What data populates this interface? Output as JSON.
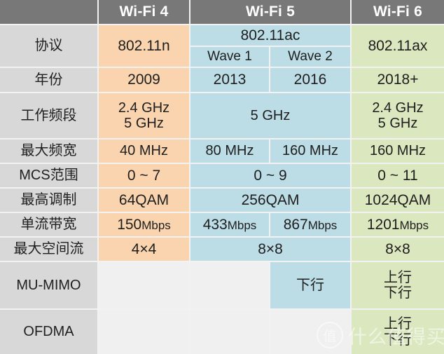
{
  "table": {
    "columns": [
      {
        "label": "",
        "name": "corner"
      },
      {
        "label": "Wi-Fi 4",
        "name": "wifi4"
      },
      {
        "label": "Wi-Fi 5",
        "name": "wifi5"
      },
      {
        "label": "Wi-Fi 6",
        "name": "wifi6"
      }
    ],
    "subcolumns": {
      "wifi5_wave1": "Wave 1",
      "wifi5_wave2": "Wave 2"
    },
    "rows": [
      {
        "label": "协议",
        "wifi4": "802.11n",
        "wifi5": "802.11ac",
        "wifi5_wave1": "Wave 1",
        "wifi5_wave2": "Wave 2",
        "wifi6": "802.11ax"
      },
      {
        "label": "年份",
        "wifi4": "2009",
        "wifi5_wave1": "2013",
        "wifi5_wave2": "2016",
        "wifi6": "2018+"
      },
      {
        "label": "工作频段",
        "wifi4_line1": "2.4 GHz",
        "wifi4_line2": "5 GHz",
        "wifi5": "5 GHz",
        "wifi6_line1": "2.4 GHz",
        "wifi6_line2": "5 GHz"
      },
      {
        "label": "最大频宽",
        "wifi4": "40 MHz",
        "wifi5_wave1": "80 MHz",
        "wifi5_wave2": "160 MHz",
        "wifi6": "160 MHz"
      },
      {
        "label": "MCS范围",
        "wifi4": "0 ~ 7",
        "wifi5": "0 ~ 9",
        "wifi6": "0 ~ 11"
      },
      {
        "label": "最高调制",
        "wifi4": "64QAM",
        "wifi5": "256QAM",
        "wifi6": "1024QAM"
      },
      {
        "label": "单流带宽",
        "wifi4_num": "150",
        "wifi4_unit": "Mbps",
        "wifi5_wave1_num": "433",
        "wifi5_wave1_unit": "Mbps",
        "wifi5_wave2_num": "867",
        "wifi5_wave2_unit": "Mbps",
        "wifi6_num": "1201",
        "wifi6_unit": "Mbps"
      },
      {
        "label": "最大空间流",
        "wifi4": "4×4",
        "wifi5": "8×8",
        "wifi6": "8×8"
      },
      {
        "label": "MU-MIMO",
        "wifi4": "",
        "wifi5_wave1": "",
        "wifi5_wave2": "下行",
        "wifi6_line1": "上行",
        "wifi6_line2": "下行"
      },
      {
        "label": "OFDMA",
        "wifi4": "",
        "wifi5_wave1": "",
        "wifi5_wave2": "",
        "wifi6_line1": "上行",
        "wifi6_line2": "下行"
      }
    ]
  },
  "watermark": {
    "badge": "值",
    "text": "什么值得买"
  },
  "colors": {
    "header": "#787878",
    "row_label": "#d8d8d8",
    "wifi4": "#fad4ae",
    "wifi5": "#bcdce6",
    "wifi6": "#dbe7bf",
    "empty": "#f0f0f0"
  }
}
